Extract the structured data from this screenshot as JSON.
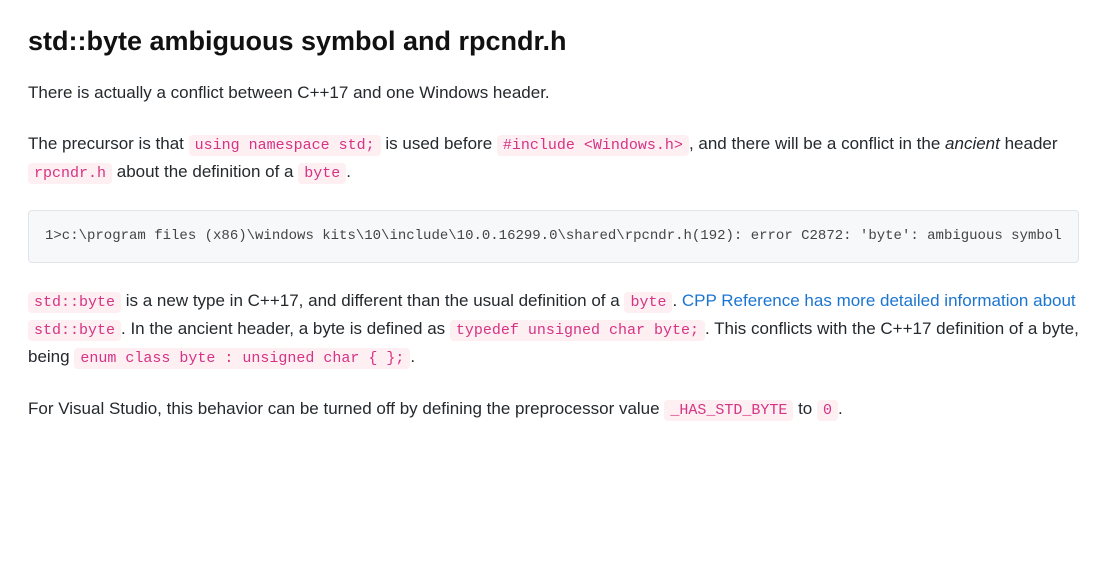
{
  "title": "std::byte ambiguous symbol and rpcndr.h",
  "p1": "There is actually a conflict between C++17 and one Windows header.",
  "p2": {
    "t1": "The precursor is that ",
    "c1": "using namespace std;",
    "t2": " is used before ",
    "c2": "#include <Windows.h>",
    "t3": ", and there will be a conflict in the ",
    "em": "ancient",
    "t4": " header ",
    "c3": "rpcndr.h",
    "t5": " about the definition of a ",
    "c4": "byte",
    "t6": "."
  },
  "codeblock": "1>c:\\program files (x86)\\windows kits\\10\\include\\10.0.16299.0\\shared\\rpcndr.h(192): error C2872: 'byte': ambiguous symbol",
  "p3": {
    "c1": "std::byte",
    "t1": " is a new type in C++17, and different than the usual definition of a ",
    "c2": "byte",
    "t2": ". ",
    "link_t1": "CPP Reference has more detailed information about ",
    "link_c1": "std::byte",
    "t3": ". In the ancient header, a byte is defined as ",
    "c3": "typedef unsigned char byte;",
    "t4": ". This conflicts with the C++17 definition of a byte, being ",
    "c4": "enum class byte : unsigned char { };",
    "t5": "."
  },
  "p4": {
    "t1": "For Visual Studio, this behavior can be turned off by defining the preprocessor value ",
    "c1": "_HAS_STD_BYTE",
    "t2": " to ",
    "c2": "0",
    "t3": "."
  }
}
